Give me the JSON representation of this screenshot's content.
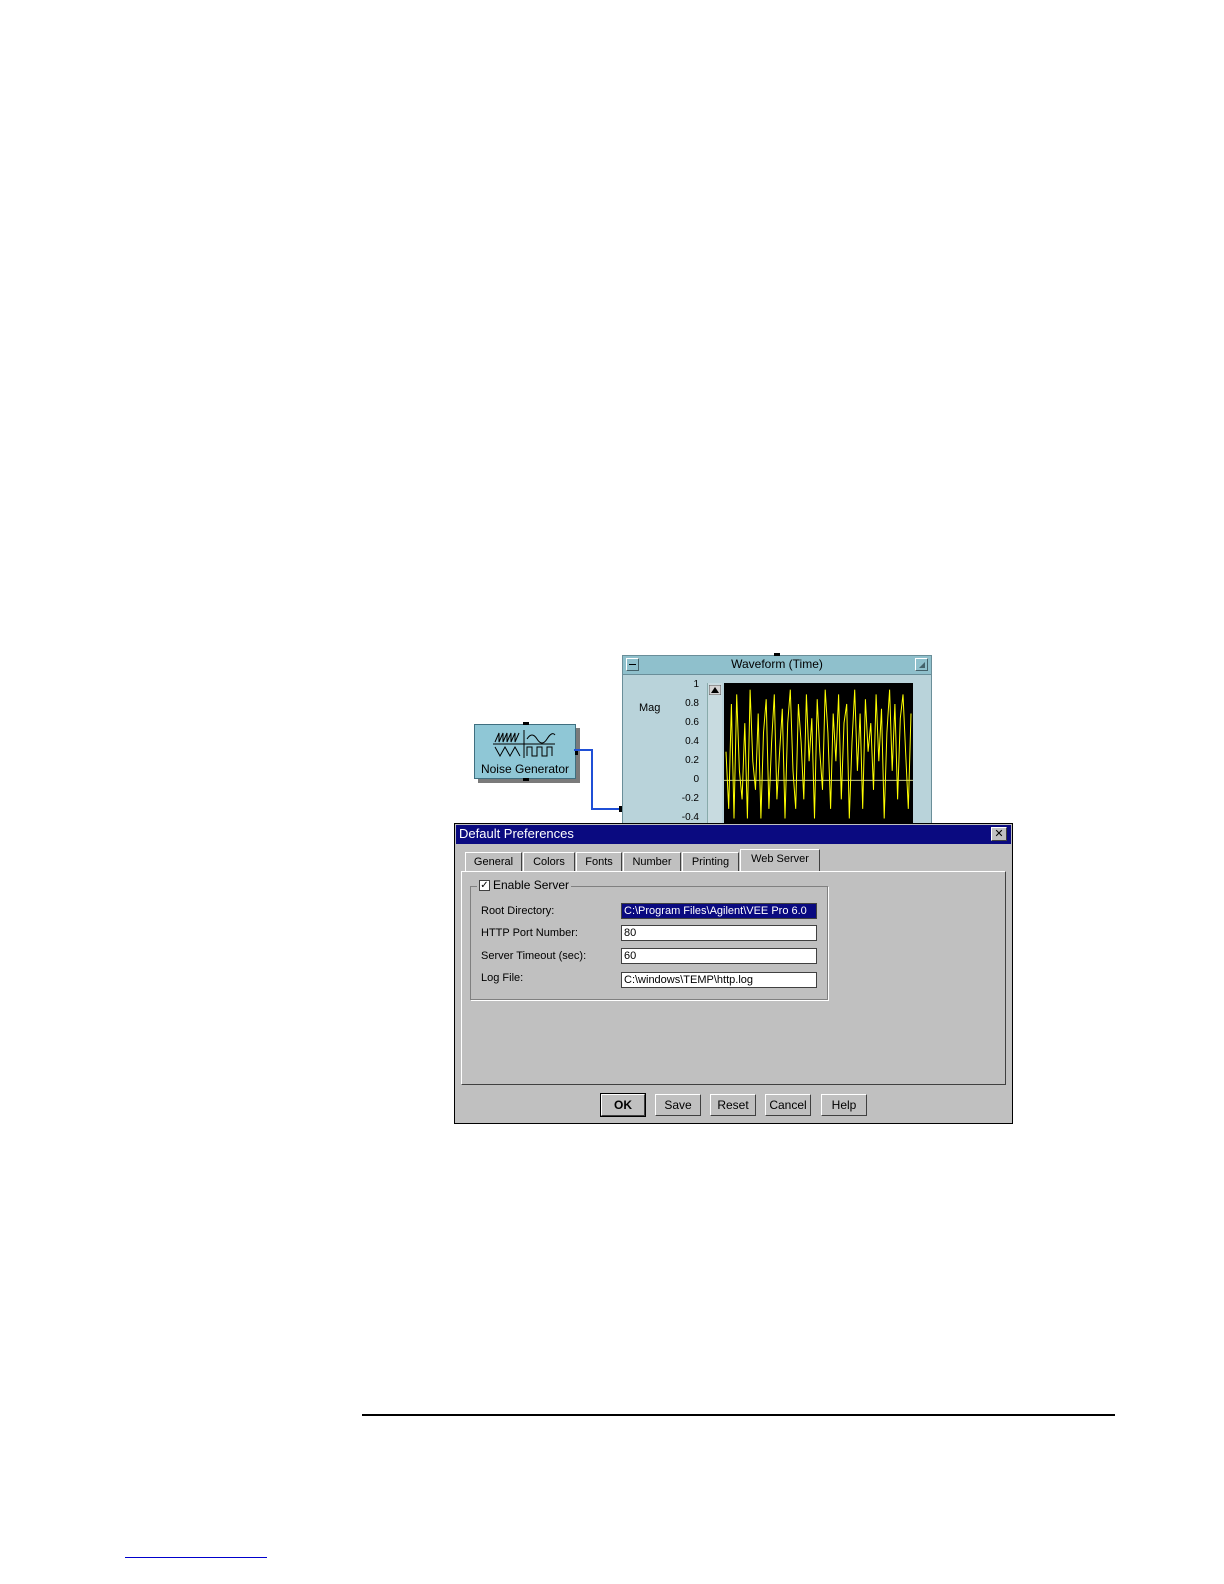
{
  "noise_generator": {
    "label": "Noise Generator",
    "icon": "function-generator-icon"
  },
  "waveform": {
    "title": "Waveform (Time)",
    "ylabel": "Mag",
    "yticks": [
      "1",
      "0.8",
      "0.6",
      "0.4",
      "0.2",
      "0",
      "-0.2",
      "-0.4"
    ]
  },
  "chart_data": {
    "type": "line",
    "title": "Waveform (Time)",
    "ylabel": "Mag",
    "ylim": [
      -0.4,
      1
    ],
    "series": [
      {
        "color": "#ffff00",
        "y": [
          0.3,
          -0.3,
          0.8,
          -0.4,
          0.9,
          0.1,
          -0.2,
          0.6,
          -0.4,
          0.95,
          0.2,
          -0.1,
          0.7,
          -0.4,
          0.5,
          0.85,
          -0.3,
          0.4,
          0.9,
          -0.2,
          0.3,
          0.75,
          -0.4,
          0.6,
          0.95,
          0.1,
          -0.3,
          0.8,
          0.4,
          -0.2,
          0.9,
          0.2,
          0.65,
          -0.4,
          0.85,
          0.3,
          -0.1,
          0.95,
          0.5,
          -0.3,
          0.7,
          0.2,
          0.9,
          -0.2,
          0.6,
          0.8,
          -0.4,
          0.4,
          0.95,
          0.1,
          0.7,
          -0.3,
          0.85,
          0.3,
          0.6,
          -0.1,
          0.9,
          0.2,
          0.75,
          -0.4,
          0.5,
          0.95,
          0.1,
          0.8,
          -0.2,
          0.65,
          0.9,
          0.3,
          -0.3,
          0.7
        ]
      }
    ],
    "grid": false
  },
  "dialog": {
    "title": "Default Preferences",
    "close": "✕",
    "tabs": [
      "General",
      "Colors",
      "Fonts",
      "Number",
      "Printing",
      "Web Server"
    ],
    "active_tab": "Web Server",
    "group_title": "Enable Server",
    "enable_checked": "✓",
    "fields": [
      {
        "label": "Root Directory:",
        "value": "C:\\Program Files\\Agilent\\VEE Pro 6.0"
      },
      {
        "label": "HTTP Port Number:",
        "value": "80"
      },
      {
        "label": "Server Timeout (sec):",
        "value": "60"
      },
      {
        "label": "Log File:",
        "value": "C:\\windows\\TEMP\\http.log"
      }
    ],
    "buttons": [
      "OK",
      "Save",
      "Reset",
      "Cancel",
      "Help"
    ]
  }
}
